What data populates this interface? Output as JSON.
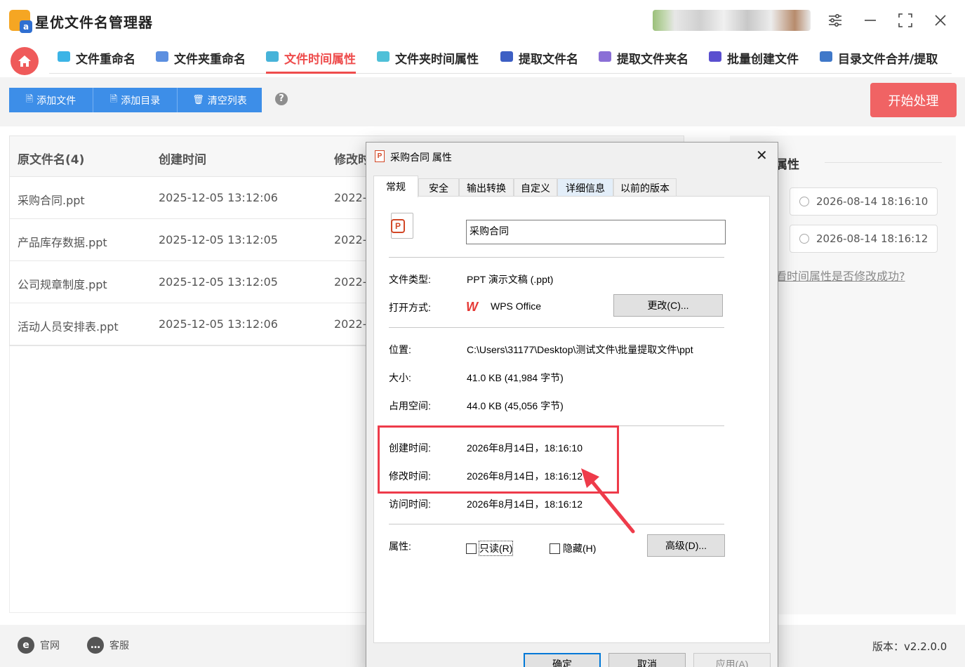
{
  "app": {
    "title": "星优文件名管理器"
  },
  "nav": {
    "tabs": [
      {
        "label": "文件重命名",
        "color": "#3cb4e6"
      },
      {
        "label": "文件夹重命名",
        "color": "#5c8fe0"
      },
      {
        "label": "文件时间属性",
        "color": "#47b3d9"
      },
      {
        "label": "文件夹时间属性",
        "color": "#4fc0d8"
      },
      {
        "label": "提取文件名",
        "color": "#3d5fc4"
      },
      {
        "label": "提取文件夹名",
        "color": "#8a6fd6"
      },
      {
        "label": "批量创建文件",
        "color": "#5a4fcf"
      },
      {
        "label": "目录文件合并/提取",
        "color": "#3f78c9"
      }
    ],
    "active_index": 2
  },
  "toolbar": {
    "add_file": "添加文件",
    "add_dir": "添加目录",
    "clear_list": "清空列表",
    "help": "?",
    "start": "开始处理"
  },
  "table": {
    "headers": [
      "原文件名(4)",
      "创建时间",
      "修改时"
    ],
    "rows": [
      {
        "name": "采购合同.ppt",
        "created": "2025-12-05 13:12:06",
        "modified": "2022-"
      },
      {
        "name": "产品库存数据.ppt",
        "created": "2025-12-05 13:12:05",
        "modified": "2022-"
      },
      {
        "name": "公司规章制度.ppt",
        "created": "2025-12-05 13:12:05",
        "modified": "2022-"
      },
      {
        "name": "活动人员安排表.ppt",
        "created": "2025-12-05 13:12:06",
        "modified": "2022-"
      }
    ]
  },
  "right_panel": {
    "title": "属性",
    "time1": "2026-08-14 18:16:10",
    "time2": "2026-08-14 18:16:12",
    "link": "看时间属性是否修改成功?"
  },
  "footer": {
    "website": "官网",
    "service": "客服",
    "version": "版本：v2.2.0.0"
  },
  "dialog": {
    "title": "采购合同 属性",
    "tabs": [
      "常规",
      "安全",
      "输出转换",
      "自定义",
      "详细信息",
      "以前的版本"
    ],
    "file_name": "采购合同",
    "type_label": "文件类型:",
    "type_value": "PPT 演示文稿 (.ppt)",
    "open_label": "打开方式:",
    "open_value": "WPS Office",
    "change_button": "更改(C)...",
    "location_label": "位置:",
    "location_value": "C:\\Users\\31177\\Desktop\\测试文件\\批量提取文件\\ppt",
    "size_label": "大小:",
    "size_value": "41.0 KB (41,984 字节)",
    "disk_label": "占用空间:",
    "disk_value": "44.0 KB (45,056 字节)",
    "created_label": "创建时间:",
    "created_value": "2026年8月14日，18:16:10",
    "modified_label": "修改时间:",
    "modified_value": "2026年8月14日，18:16:12",
    "accessed_label": "访问时间:",
    "accessed_value": "2026年8月14日，18:16:12",
    "attr_label": "属性:",
    "readonly_label": "只读(R)",
    "hidden_label": "隐藏(H)",
    "advanced_button": "高级(D)...",
    "ok": "确定",
    "cancel": "取消",
    "apply": "应用(A)"
  },
  "colors": {
    "accent_red": "#ee4c4c",
    "toolbar_blue": "#3d8ee8",
    "highlight_box": "#ee3b4a"
  }
}
